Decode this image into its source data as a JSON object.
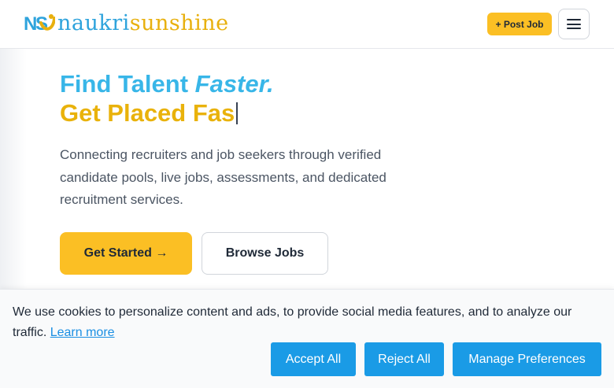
{
  "header": {
    "logo": {
      "mark_text": "NS",
      "name_part1": "naukri",
      "name_part2": "sunshine"
    },
    "post_job_label": "+ Post Job",
    "menu_icon": "hamburger-icon"
  },
  "hero": {
    "title_line1_plain": "Find Talent ",
    "title_line1_emph": "Faster.",
    "title_line2": "Get Placed Fas",
    "description": "Connecting recruiters and job seekers through verified candidate pools, live jobs, assessments, and dedicated recruitment services.",
    "get_started_label": "Get Started →",
    "browse_jobs_label": "Browse Jobs"
  },
  "cookie_banner": {
    "message": "We use cookies to personalize content and ads, to provide social media features, and to analyze our traffic.",
    "learn_more_label": "Learn more",
    "accept_label": "Accept All",
    "reject_label": "Reject All",
    "manage_label": "Manage Preferences"
  },
  "colors": {
    "brand_blue": "#38b6e8",
    "brand_yellow": "#fbbf24",
    "cookie_button": "#1a9be6"
  }
}
